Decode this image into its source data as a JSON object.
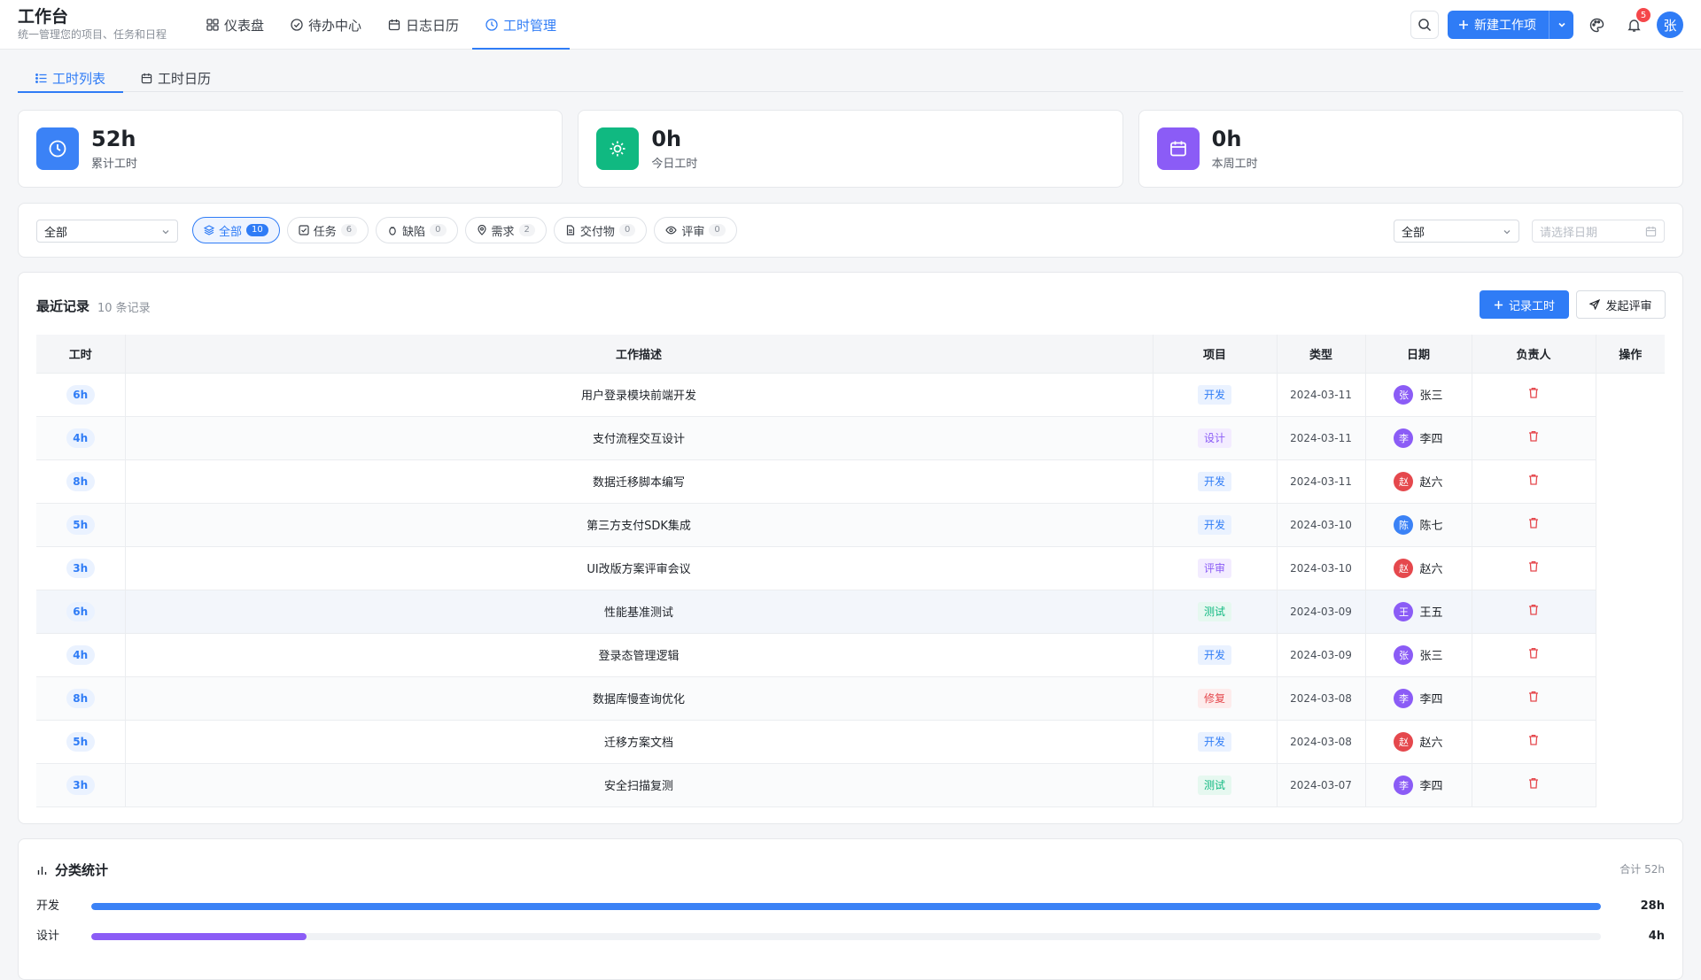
{
  "app": {
    "title": "工作台",
    "subtitle": "统一管理您的项目、任务和日程"
  },
  "nav": [
    {
      "label": "仪表盘",
      "icon": "grid-icon",
      "active": false
    },
    {
      "label": "待办中心",
      "icon": "check-circle-icon",
      "active": false
    },
    {
      "label": "日志日历",
      "icon": "calendar-icon",
      "active": false
    },
    {
      "label": "工时管理",
      "icon": "clock-icon",
      "active": true
    }
  ],
  "header": {
    "new_item_label": "新建工作项",
    "notification_count": "5",
    "user_initial": "张"
  },
  "subtabs": [
    {
      "label": "工时列表",
      "icon": "list-icon",
      "active": true
    },
    {
      "label": "工时日历",
      "icon": "calendar-icon",
      "active": false
    }
  ],
  "stats": [
    {
      "value": "52h",
      "label": "累计工时",
      "color": "#3b82f6",
      "icon": "clock-icon"
    },
    {
      "value": "0h",
      "label": "今日工时",
      "color": "#10b981",
      "icon": "sun-icon"
    },
    {
      "value": "0h",
      "label": "本周工时",
      "color": "#8b5cf6",
      "icon": "calendar-icon"
    }
  ],
  "filters": {
    "project_select": "全部",
    "owner_select": "全部",
    "date_placeholder": "请选择日期",
    "chips": [
      {
        "label": "全部",
        "count": "10",
        "icon": "layers-icon",
        "active": true
      },
      {
        "label": "任务",
        "count": "6",
        "icon": "checkbox-icon",
        "active": false
      },
      {
        "label": "缺陷",
        "count": "0",
        "icon": "bug-icon",
        "active": false
      },
      {
        "label": "需求",
        "count": "2",
        "icon": "pin-icon",
        "active": false
      },
      {
        "label": "交付物",
        "count": "0",
        "icon": "file-icon",
        "active": false
      },
      {
        "label": "评审",
        "count": "0",
        "icon": "eye-icon",
        "active": false
      }
    ]
  },
  "records": {
    "title": "最近记录",
    "count_text": "10 条记录",
    "log_button": "记录工时",
    "review_button": "发起评审",
    "columns": [
      "工时",
      "工作描述",
      "项目",
      "类型",
      "日期",
      "负责人",
      "操作"
    ],
    "rows": [
      {
        "hours": "6h",
        "desc": "用户登录模块前端开发",
        "tag": "开发",
        "date": "2024-03-11",
        "owner": "张三",
        "initial": "张"
      },
      {
        "hours": "4h",
        "desc": "支付流程交互设计",
        "tag": "设计",
        "date": "2024-03-11",
        "owner": "李四",
        "initial": "李"
      },
      {
        "hours": "8h",
        "desc": "数据迁移脚本编写",
        "tag": "开发",
        "date": "2024-03-11",
        "owner": "赵六",
        "initial": "赵"
      },
      {
        "hours": "5h",
        "desc": "第三方支付SDK集成",
        "tag": "开发",
        "date": "2024-03-10",
        "owner": "陈七",
        "initial": "陈"
      },
      {
        "hours": "3h",
        "desc": "UI改版方案评审会议",
        "tag": "评审",
        "date": "2024-03-10",
        "owner": "赵六",
        "initial": "赵"
      },
      {
        "hours": "6h",
        "desc": "性能基准测试",
        "tag": "测试",
        "date": "2024-03-09",
        "owner": "王五",
        "initial": "王"
      },
      {
        "hours": "4h",
        "desc": "登录态管理逻辑",
        "tag": "开发",
        "date": "2024-03-09",
        "owner": "张三",
        "initial": "张"
      },
      {
        "hours": "8h",
        "desc": "数据库慢查询优化",
        "tag": "修复",
        "date": "2024-03-08",
        "owner": "李四",
        "initial": "李"
      },
      {
        "hours": "5h",
        "desc": "迁移方案文档",
        "tag": "开发",
        "date": "2024-03-08",
        "owner": "赵六",
        "initial": "赵"
      },
      {
        "hours": "3h",
        "desc": "安全扫描复测",
        "tag": "测试",
        "date": "2024-03-07",
        "owner": "李四",
        "initial": "李"
      }
    ]
  },
  "tag_colors": {
    "开发": {
      "bg": "#eaf2ff",
      "fg": "#2f7cf6"
    },
    "设计": {
      "bg": "#f3ecff",
      "fg": "#8b5cf6"
    },
    "评审": {
      "bg": "#f3ecff",
      "fg": "#8b5cf6"
    },
    "测试": {
      "bg": "#e6f8f0",
      "fg": "#10b981"
    },
    "修复": {
      "bg": "#fdecec",
      "fg": "#e5484d"
    }
  },
  "avatar_colors": {
    "张": "#8b5cf6",
    "李": "#8b5cf6",
    "赵": "#e5484d",
    "陈": "#3b82f6",
    "王": "#8b5cf6"
  },
  "category": {
    "title": "分类统计",
    "total_text": "合计 52h",
    "total_hours": 52,
    "items": [
      {
        "name": "开发",
        "hours": 28,
        "value_text": "28h",
        "color": "#3b82f6"
      },
      {
        "name": "设计",
        "hours": 4,
        "value_text": "4h",
        "color": "#8b5cf6"
      }
    ]
  }
}
